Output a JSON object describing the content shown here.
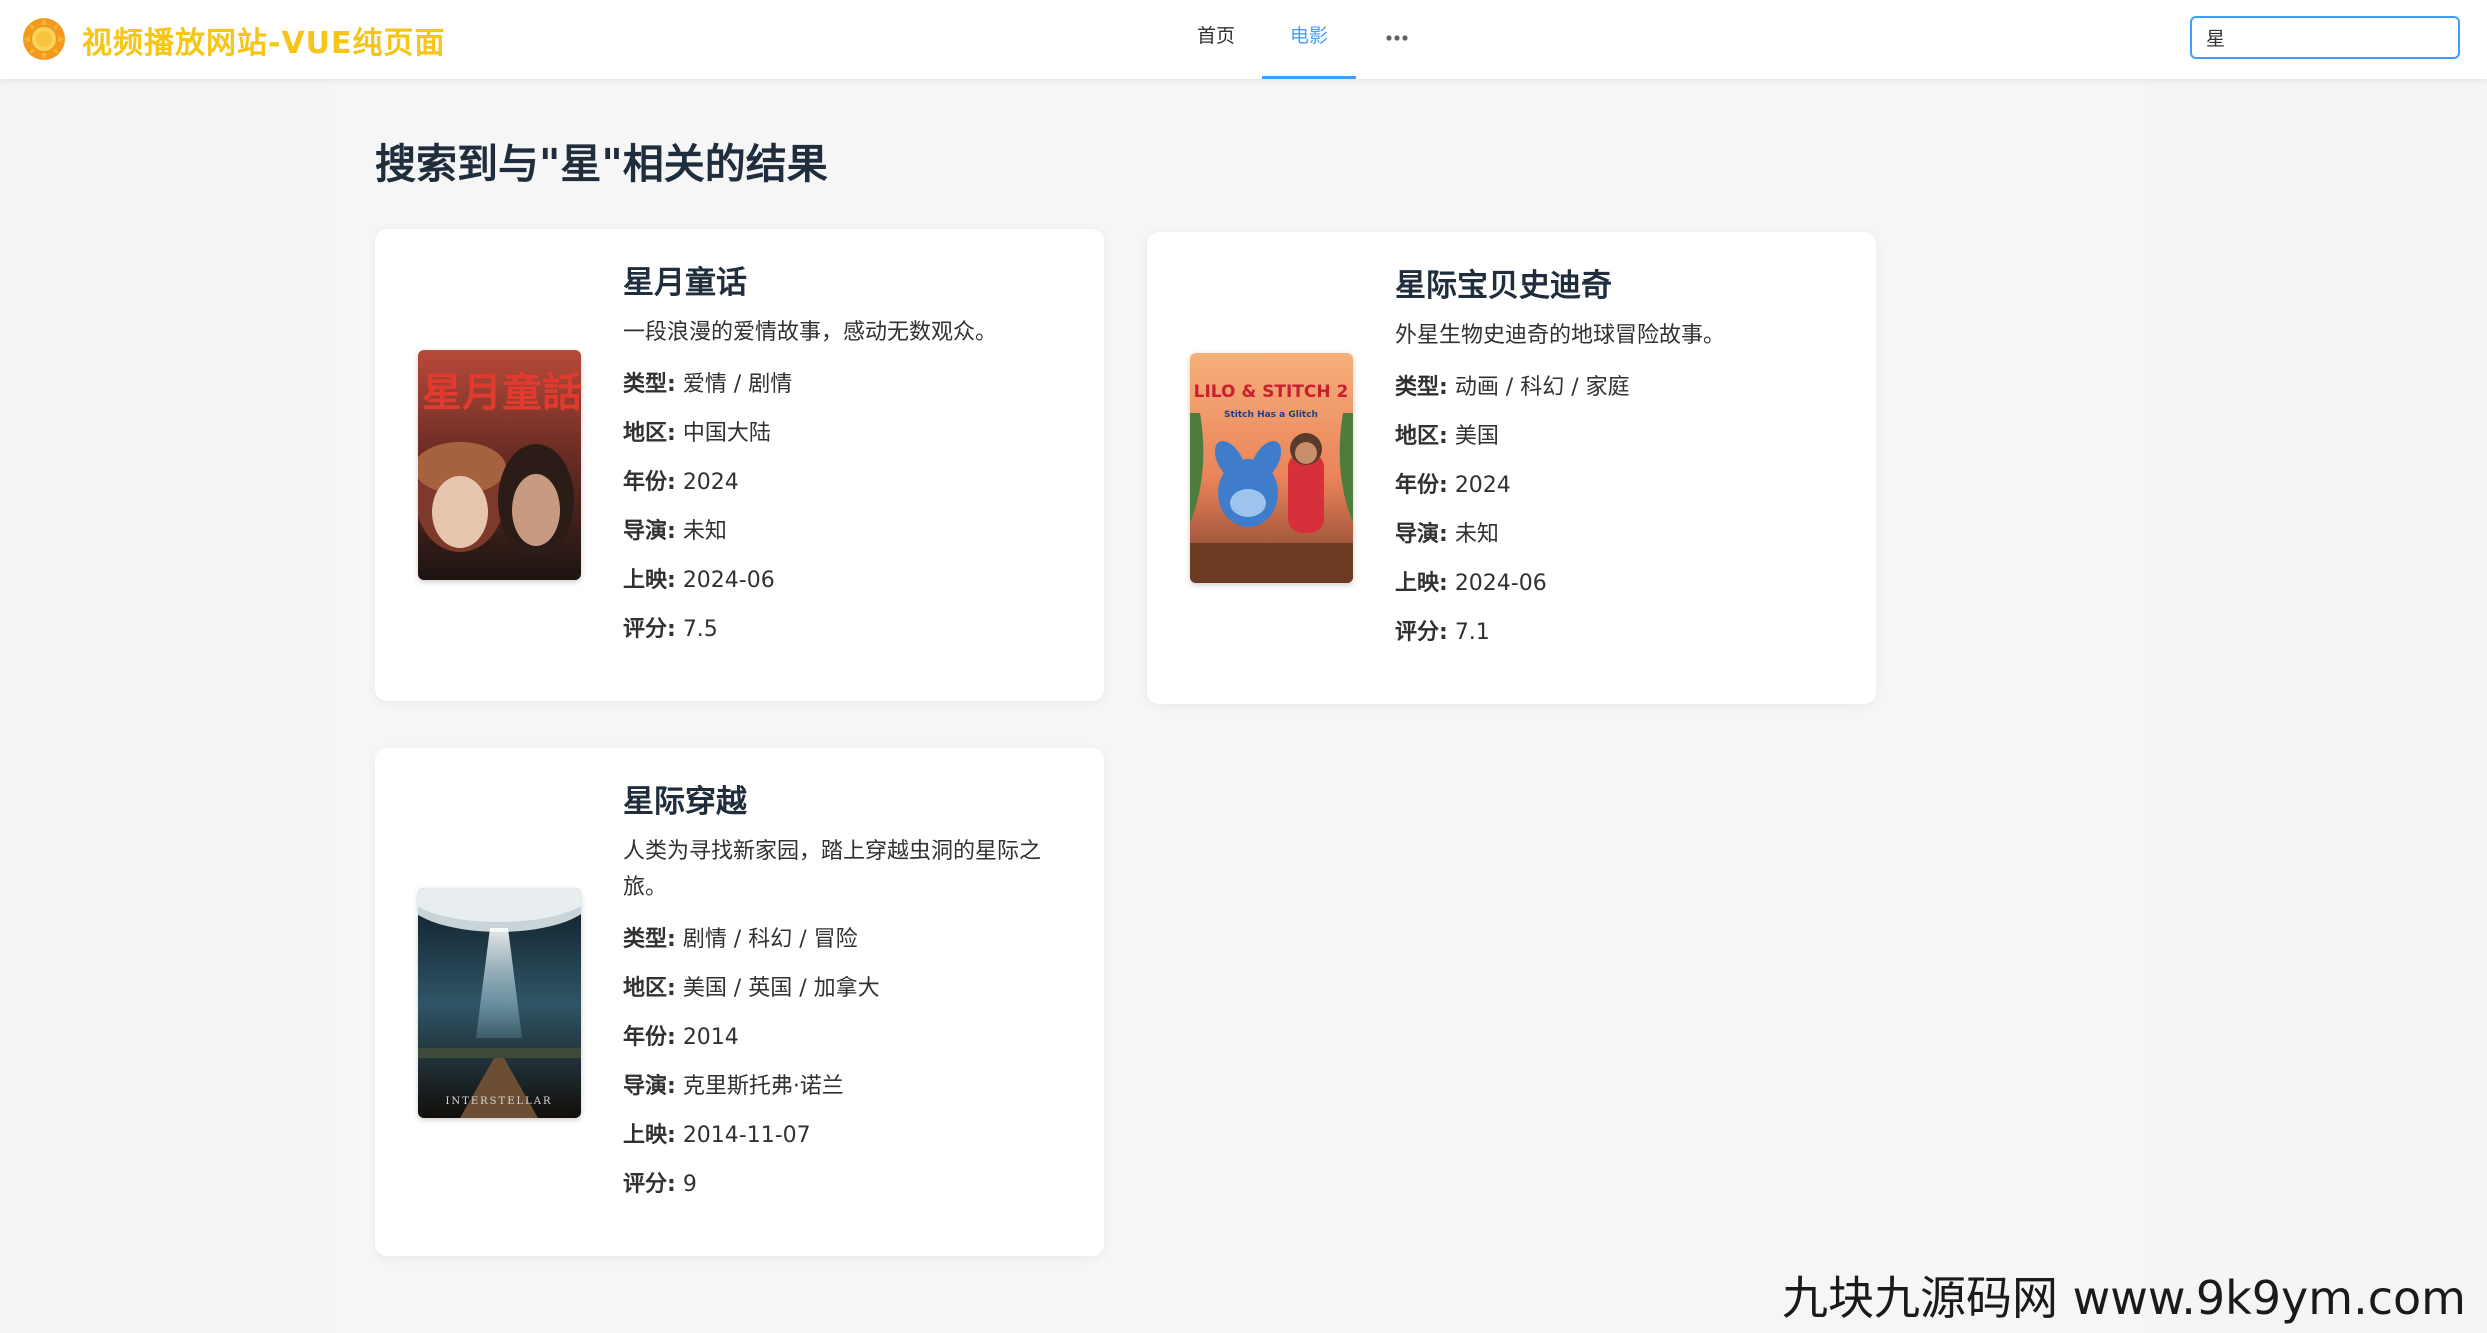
{
  "header": {
    "site_title": "视频播放网站-VUE纯页面",
    "nav": {
      "home": "首页",
      "movie": "电影",
      "more": "•••"
    },
    "search": {
      "value": "星"
    }
  },
  "main": {
    "result_title": "搜索到与\"星\"相关的结果",
    "labels": {
      "genre": "类型:",
      "region": "地区:",
      "year": "年份:",
      "director": "导演:",
      "release": "上映:",
      "rating": "评分:"
    },
    "movies": [
      {
        "title": "星月童话",
        "poster_text": "星月童話",
        "desc": "一段浪漫的爱情故事，感动无数观众。",
        "genre": "爱情 / 剧情",
        "region": "中国大陆",
        "year": "2024",
        "director": "未知",
        "release": "2024-06",
        "rating": "7.5"
      },
      {
        "title": "星际宝贝史迪奇",
        "poster_text_1": "LILO & STITCH 2",
        "poster_text_2": "Stitch Has a Glitch",
        "desc": "外星生物史迪奇的地球冒险故事。",
        "genre": "动画 / 科幻 / 家庭",
        "region": "美国",
        "year": "2024",
        "director": "未知",
        "release": "2024-06",
        "rating": "7.1"
      },
      {
        "title": "星际穿越",
        "poster_text": "INTERSTELLAR",
        "desc": "人类为寻找新家园，踏上穿越虫洞的星际之旅。",
        "genre": "剧情 / 科幻 / 冒险",
        "region": "美国 / 英国 / 加拿大",
        "year": "2014",
        "director": "克里斯托弗·诺兰",
        "release": "2014-11-07",
        "rating": "9"
      }
    ]
  },
  "watermark": "九块九源码网 www.9k9ym.com",
  "colors": {
    "accent": "#409eff",
    "brand": "#f5c518",
    "title": "#1f2d3d"
  }
}
